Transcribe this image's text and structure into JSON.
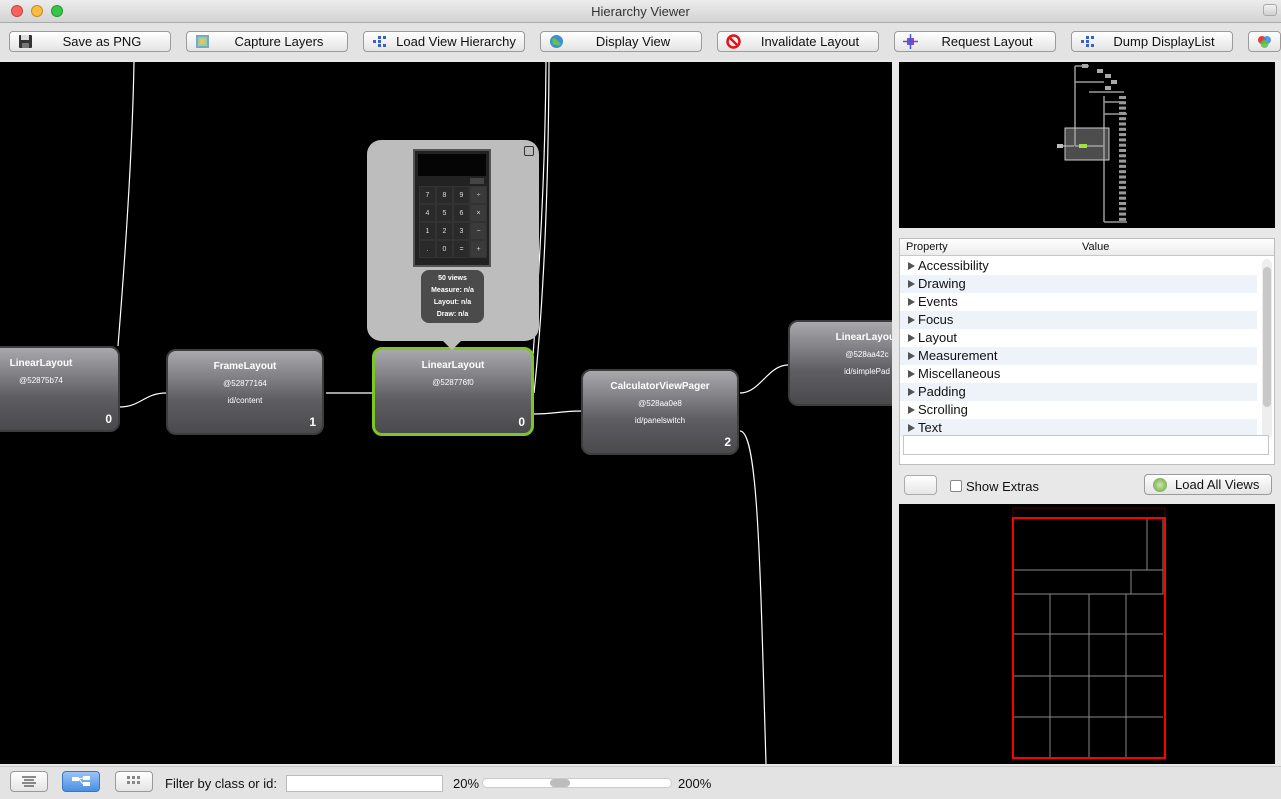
{
  "window": {
    "title": "Hierarchy Viewer"
  },
  "toolbar": {
    "save_png": "Save as PNG",
    "capture_layers": "Capture Layers",
    "load_view_hierarchy": "Load View Hierarchy",
    "display_view": "Display View",
    "invalidate_layout": "Invalidate Layout",
    "request_layout": "Request Layout",
    "dump_displaylist": "Dump DisplayList"
  },
  "nodes": [
    {
      "name": "LinearLayout",
      "hash": "@52875b74",
      "id": "",
      "index": "0"
    },
    {
      "name": "FrameLayout",
      "hash": "@52877164",
      "id": "id/content",
      "index": "1"
    },
    {
      "name": "LinearLayout",
      "hash": "@528776f0",
      "id": "",
      "index": "0"
    },
    {
      "name": "CalculatorViewPager",
      "hash": "@528aa0e8",
      "id": "id/panelswitch",
      "index": "2"
    },
    {
      "name": "LinearLayout",
      "hash": "@528aa42c",
      "id": "id/simplePad",
      "index": ""
    }
  ],
  "popup": {
    "views": "50 views",
    "measure": "Measure: n/a",
    "layout": "Layout: n/a",
    "draw": "Draw: n/a",
    "keys": [
      "7",
      "8",
      "9",
      "÷",
      "4",
      "5",
      "6",
      "×",
      "1",
      "2",
      "3",
      "−",
      ".",
      "0",
      "=",
      "+"
    ]
  },
  "properties": {
    "header_property": "Property",
    "header_value": "Value",
    "categories": [
      "Accessibility",
      "Drawing",
      "Events",
      "Focus",
      "Layout",
      "Measurement",
      "Miscellaneous",
      "Padding",
      "Scrolling",
      "Text"
    ]
  },
  "controls": {
    "show_extras": "Show Extras",
    "load_all_views": "Load All Views"
  },
  "status": {
    "filter_label": "Filter by class or id:",
    "filter_value": "",
    "zoom_min": "20%",
    "zoom_max": "200%",
    "zoom_level": 0.4
  },
  "colors": {
    "selected_border": "#7fc52a",
    "layout_outline": "#ff0000"
  }
}
